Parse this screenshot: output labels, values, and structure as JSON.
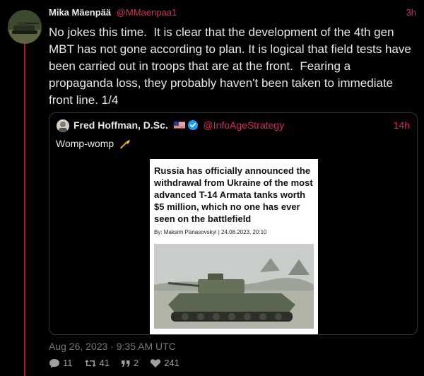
{
  "tweet": {
    "author_name": "Mika Mäenpää",
    "handle": "@MMaenpaa1",
    "time": "3h",
    "text": "No jokes this time.  It is clear that the development of the 4th gen MBT has not gone according to plan. It is logical that field tests have been carried out in troops that are at the front.  Fearing a propaganda loss, they probably haven't been taken to immediate front line. 1/4",
    "timestamp": "Aug 26, 2023 · 9:35 AM UTC"
  },
  "quote": {
    "author_name": "Fred Hoffman, D.Sc.",
    "handle": "@InfoAgeStrategy",
    "time": "14h",
    "text": "Womp-womp"
  },
  "article": {
    "title": "Russia has officially announced the withdrawal from Ukraine of the most advanced T-14 Armata tanks worth $5 million, which no one has ever seen on the battlefield",
    "byline": "By: Maksim Panasovskyi | 24.08.2023, 20:10"
  },
  "stats": {
    "replies": "11",
    "retweets": "41",
    "quotes": "2",
    "likes": "241"
  },
  "icons": {
    "reply": "reply-icon",
    "retweet": "retweet-icon",
    "quote": "quote-icon",
    "like": "heart-icon",
    "verified": "verified-badge-icon",
    "flag": "us-flag-icon",
    "trumpet": "trumpet-emoji-icon"
  },
  "colors": {
    "accent": "#e0245e",
    "background": "#000000",
    "text": "#e7e9ea",
    "muted": "#71767b",
    "thread_line": "#9b1b2a",
    "verified": "#1d9bf0"
  }
}
